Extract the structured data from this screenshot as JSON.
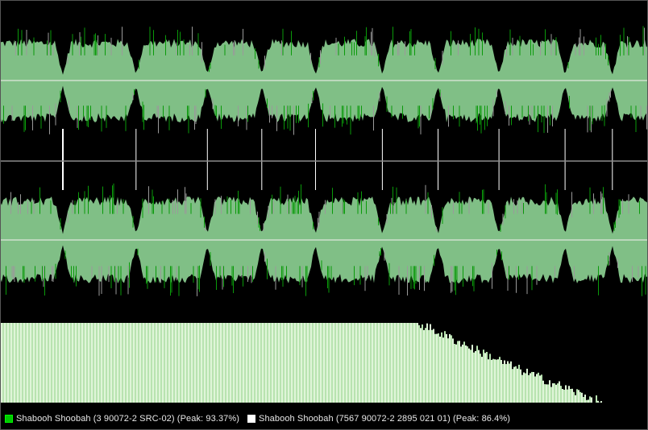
{
  "colors": {
    "background": "#000000",
    "wave_fill": "#80bf86",
    "wave_peak_green": "#0a9a0a",
    "wave_peak_gray": "#9a9a9a",
    "center_line": "#dfe8dc",
    "divider": "#8c8c8c",
    "track_marker": "#ffffff",
    "spectrum_fill": "#dff5d8",
    "spectrum_line": "#b8e3b0"
  },
  "tracks": [
    {
      "start": 0.0
    },
    {
      "start": 0.097
    },
    {
      "start": 0.21
    },
    {
      "start": 0.32
    },
    {
      "start": 0.404
    },
    {
      "start": 0.487
    },
    {
      "start": 0.59
    },
    {
      "start": 0.676
    },
    {
      "start": 0.77
    },
    {
      "start": 0.872
    },
    {
      "start": 0.945
    }
  ],
  "spectrum_profile": {
    "flat_until": 0.645,
    "steep_drop_until": 0.8,
    "end": 0.93,
    "level_after_drop": 0.42
  },
  "legend": [
    {
      "label": "Shabooh Shoobah (3 90072-2 SRC-02) (Peak: 93.37%)",
      "swatch_color": "#00c800"
    },
    {
      "label": "Shabooh Shoobah (7567 90072-2 2895 021 01) (Peak: 86.4%)",
      "swatch_color": "#ffffff"
    }
  ]
}
